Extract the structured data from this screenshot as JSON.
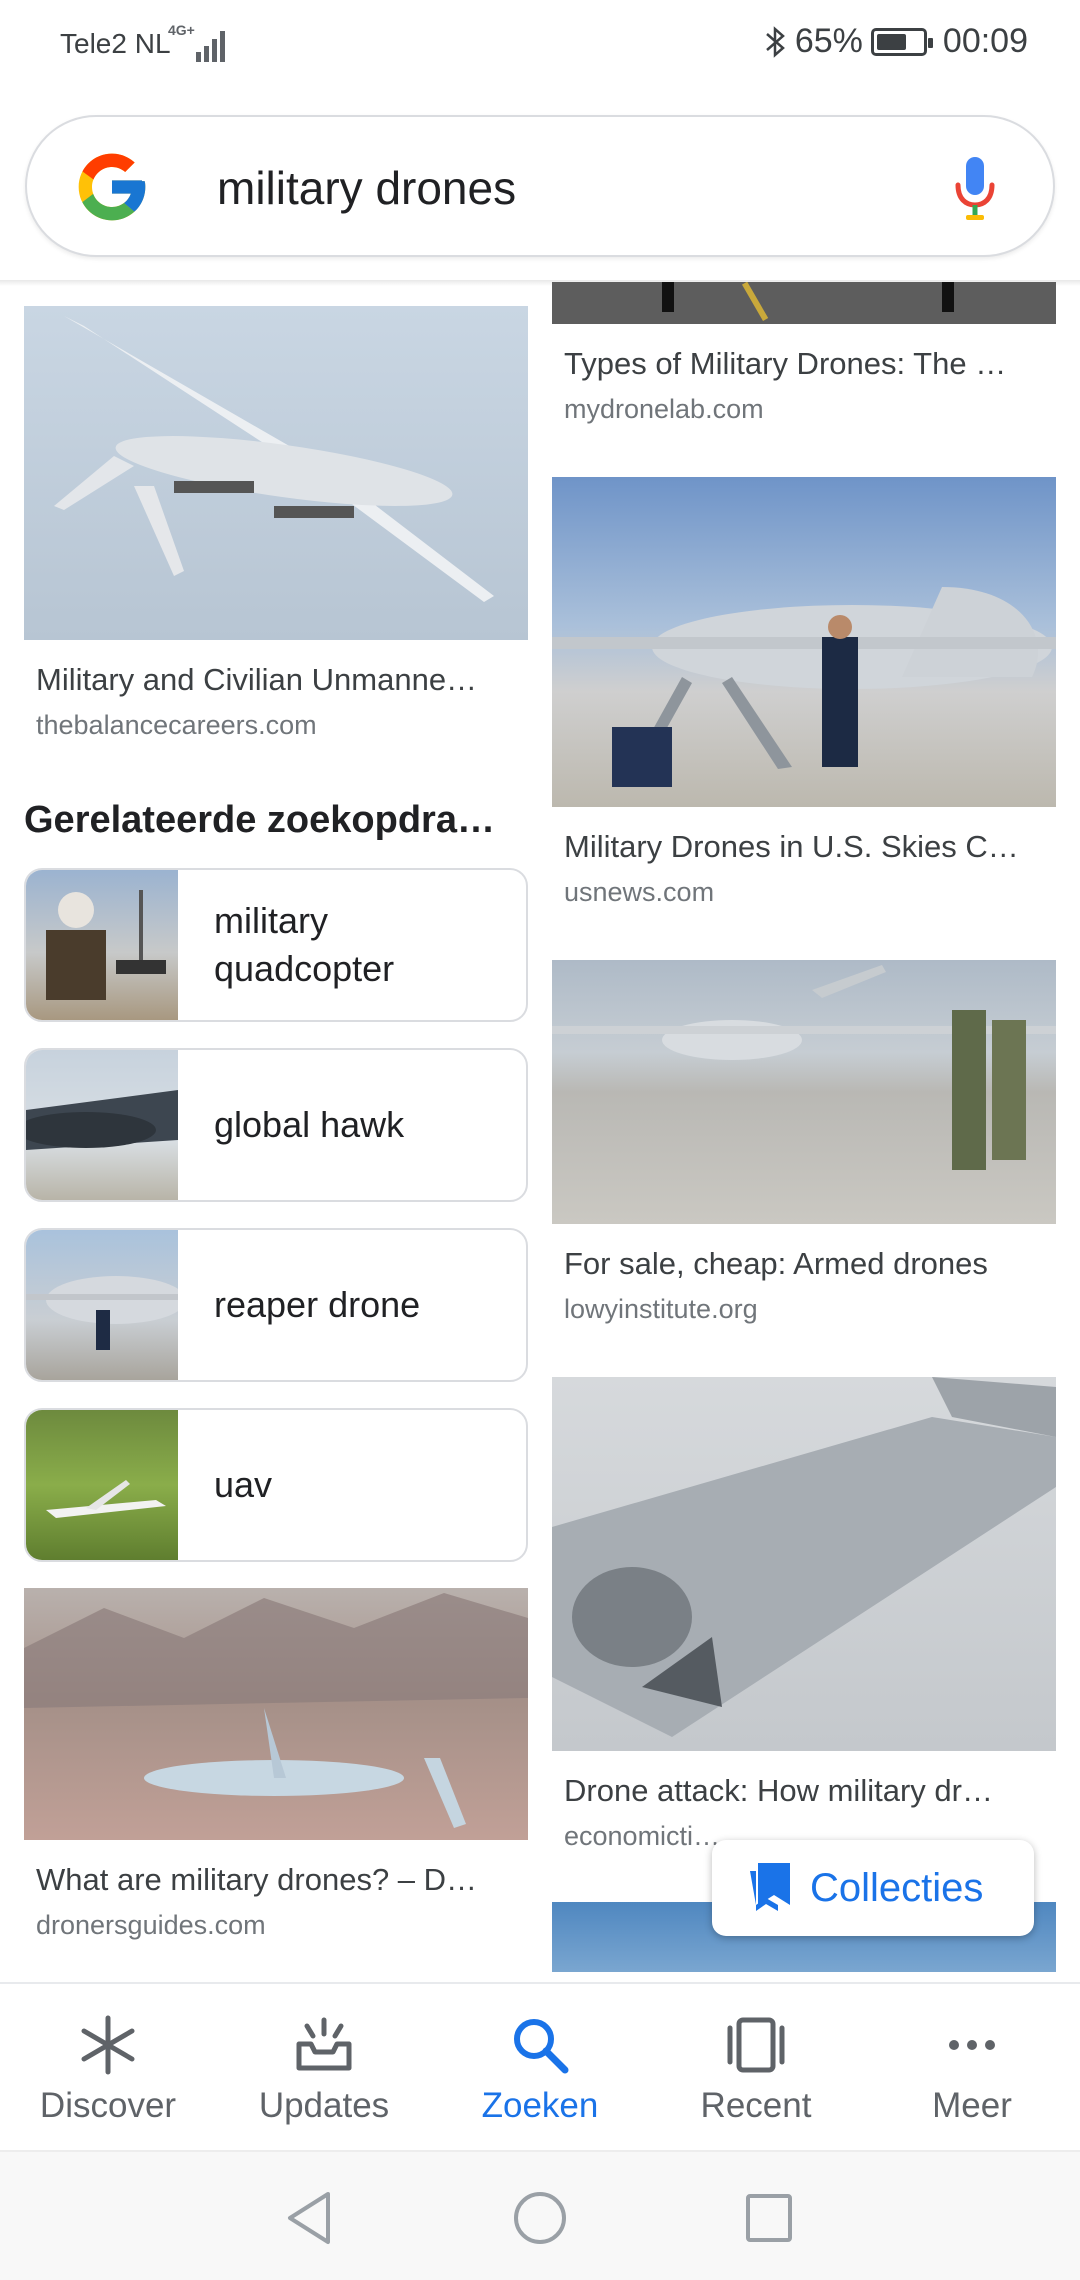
{
  "status_bar": {
    "carrier": "Tele2 NL",
    "network": "4G+",
    "battery": "65%",
    "battery_level": 0.65,
    "time": "00:09"
  },
  "search": {
    "query": "military drones"
  },
  "results_left": [
    {
      "title": "Military and Civilian Unmanne…",
      "source": "thebalancecareers.com"
    },
    {
      "title": "What are military drones? – D…",
      "source": "dronersguides.com"
    }
  ],
  "results_right": [
    {
      "title": "Types of Military Drones: The …",
      "source": "mydronelab.com"
    },
    {
      "title": "Military Drones in U.S. Skies C…",
      "source": "usnews.com"
    },
    {
      "title": "For sale, cheap: Armed drones",
      "source": "lowyinstitute.org"
    },
    {
      "title": "Drone attack: How military dr…",
      "source": "economicti…"
    }
  ],
  "related": {
    "heading": "Gerelateerde zoekopdra…",
    "items": [
      {
        "line1": "military",
        "line2": "quadcopter"
      },
      {
        "line1": "global hawk"
      },
      {
        "line1": "reaper drone"
      },
      {
        "line1": "uav"
      }
    ]
  },
  "collections_button": "Collecties",
  "bottom_nav": [
    {
      "label": "Discover",
      "icon": "asterisk-icon"
    },
    {
      "label": "Updates",
      "icon": "updates-icon"
    },
    {
      "label": "Zoeken",
      "icon": "search-icon",
      "active": true
    },
    {
      "label": "Recent",
      "icon": "recent-icon"
    },
    {
      "label": "Meer",
      "icon": "more-icon"
    }
  ],
  "colors": {
    "accent": "#1a73e8",
    "text": "#202124",
    "secondary": "#70757a"
  }
}
